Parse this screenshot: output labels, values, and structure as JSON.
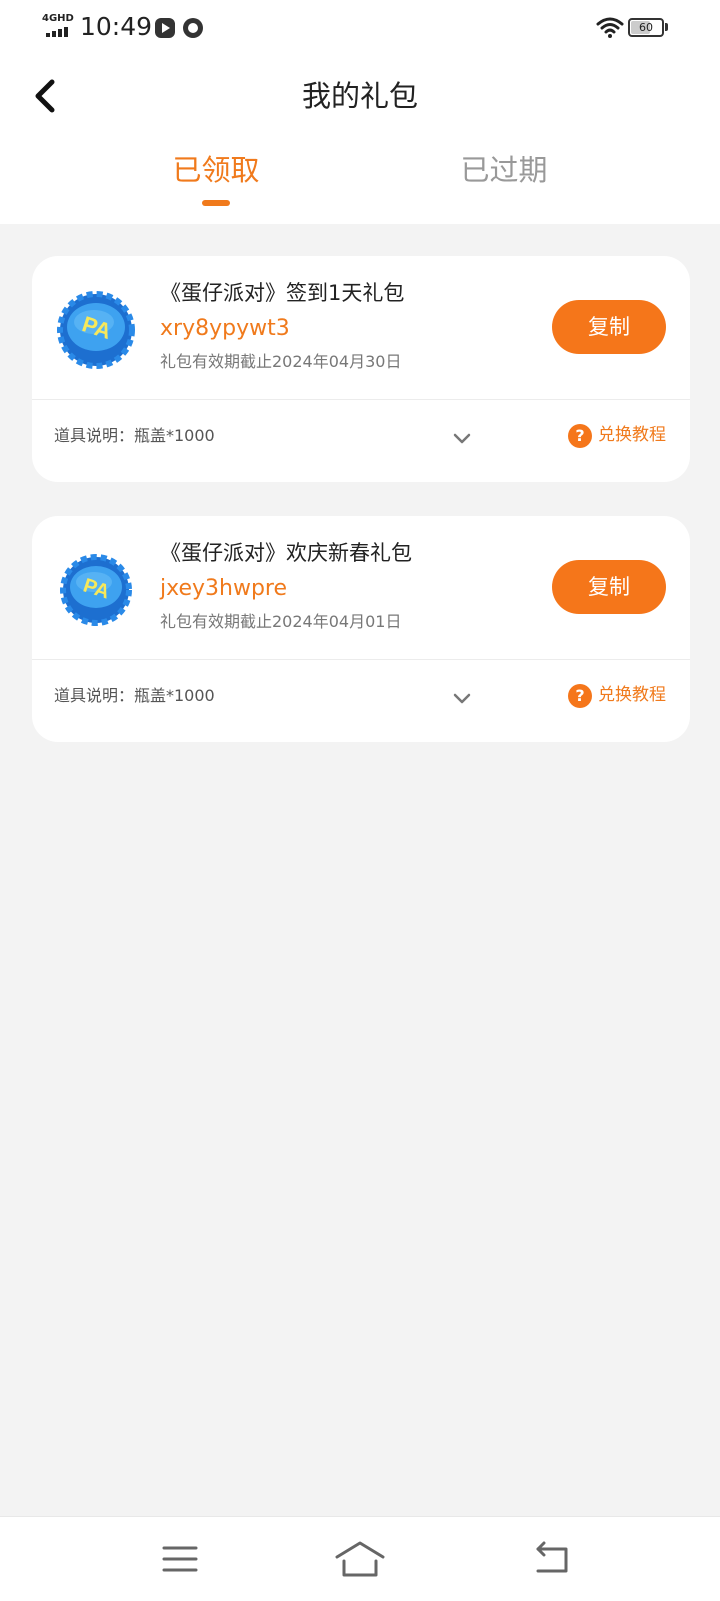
{
  "status_bar": {
    "network": "4GHD",
    "time": "10:49",
    "battery": "60"
  },
  "header": {
    "title": "我的礼包",
    "back_icon": "back-arrow-icon"
  },
  "tabs": [
    {
      "label": "已领取",
      "active": true
    },
    {
      "label": "已过期",
      "active": false
    }
  ],
  "gifts": [
    {
      "title": "《蛋仔派对》签到1天礼包",
      "code": "xry8ypywt3",
      "expiry": "礼包有效期截止2024年04月30日",
      "copy_label": "复制",
      "description": "道具说明：瓶盖*1000",
      "help_label": "兑换教程",
      "icon": "bottle-cap-icon"
    },
    {
      "title": "《蛋仔派对》欢庆新春礼包",
      "code": "jxey3hwpre",
      "expiry": "礼包有效期截止2024年04月01日",
      "copy_label": "复制",
      "description": "道具说明：瓶盖*1000",
      "help_label": "兑换教程",
      "icon": "bottle-cap-icon"
    }
  ],
  "nav_bar": {
    "icons": [
      "menu-icon",
      "home-icon",
      "back-icon"
    ]
  },
  "colors": {
    "accent": "#f07a1c",
    "button": "#f5761a",
    "background": "#f3f3f3"
  }
}
